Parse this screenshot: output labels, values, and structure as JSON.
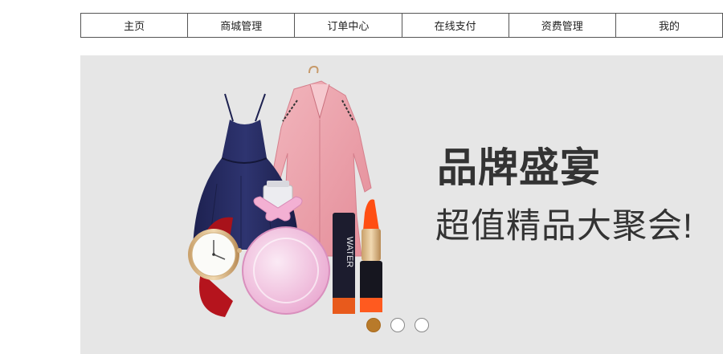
{
  "nav": {
    "items": [
      {
        "label": "主页"
      },
      {
        "label": "商城管理"
      },
      {
        "label": "订单中心"
      },
      {
        "label": "在线支付"
      },
      {
        "label": "资费管理"
      },
      {
        "label": "我的"
      }
    ]
  },
  "banner": {
    "headline": "品牌盛宴",
    "subline": "超值精品大聚会!",
    "lipstick_case_text": "WATER",
    "carousel": {
      "slides": 3,
      "active_index": 0,
      "active_color": "#b87a2a"
    }
  }
}
